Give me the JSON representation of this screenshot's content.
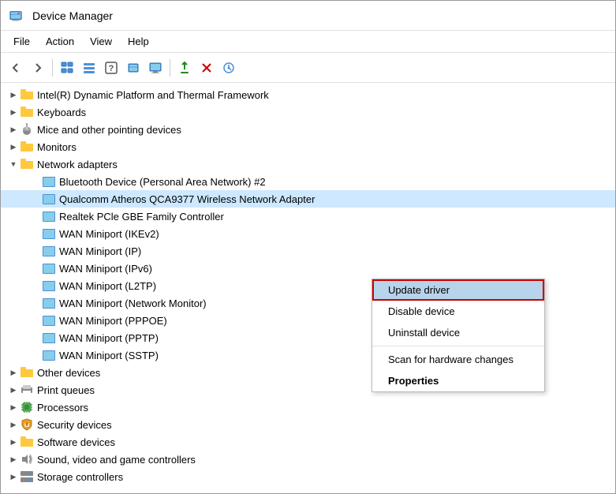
{
  "window": {
    "title": "Device Manager"
  },
  "menubar": {
    "items": [
      "File",
      "Action",
      "View",
      "Help"
    ]
  },
  "toolbar": {
    "buttons": [
      {
        "name": "back",
        "symbol": "◀"
      },
      {
        "name": "forward",
        "symbol": "▶"
      },
      {
        "name": "tree-view",
        "symbol": "⊞"
      },
      {
        "name": "list-view",
        "symbol": "☰"
      },
      {
        "name": "help",
        "symbol": "?"
      },
      {
        "name": "resources-by-type",
        "symbol": "⊟"
      },
      {
        "name": "monitor",
        "symbol": "🖥"
      },
      {
        "name": "update",
        "symbol": "↑"
      },
      {
        "name": "uninstall",
        "symbol": "✖"
      },
      {
        "name": "scan",
        "symbol": "⊕"
      }
    ]
  },
  "tree": {
    "items": [
      {
        "id": "intel-dynamic",
        "level": 1,
        "expanded": false,
        "label": "Intel(R) Dynamic Platform and Thermal Framework",
        "icon": "folder"
      },
      {
        "id": "keyboards",
        "level": 1,
        "expanded": false,
        "label": "Keyboards",
        "icon": "folder"
      },
      {
        "id": "mice",
        "level": 1,
        "expanded": false,
        "label": "Mice and other pointing devices",
        "icon": "mouse"
      },
      {
        "id": "monitors",
        "level": 1,
        "expanded": false,
        "label": "Monitors",
        "icon": "monitor"
      },
      {
        "id": "network-adapters",
        "level": 1,
        "expanded": true,
        "label": "Network adapters",
        "icon": "folder"
      },
      {
        "id": "bluetooth",
        "level": 2,
        "expanded": false,
        "label": "Bluetooth Device (Personal Area Network) #2",
        "icon": "net"
      },
      {
        "id": "qualcomm",
        "level": 2,
        "expanded": false,
        "label": "Qualcomm Atheros QCA9377 Wireless Network Adapter",
        "icon": "net",
        "selected": true
      },
      {
        "id": "realtek",
        "level": 2,
        "expanded": false,
        "label": "Realtek PCle GBE Family Controller",
        "icon": "net"
      },
      {
        "id": "wan-ikev2",
        "level": 2,
        "expanded": false,
        "label": "WAN Miniport (IKEv2)",
        "icon": "net"
      },
      {
        "id": "wan-ip",
        "level": 2,
        "expanded": false,
        "label": "WAN Miniport (IP)",
        "icon": "net"
      },
      {
        "id": "wan-ipv6",
        "level": 2,
        "expanded": false,
        "label": "WAN Miniport (IPv6)",
        "icon": "net"
      },
      {
        "id": "wan-l2tp",
        "level": 2,
        "expanded": false,
        "label": "WAN Miniport (L2TP)",
        "icon": "net"
      },
      {
        "id": "wan-netmon",
        "level": 2,
        "expanded": false,
        "label": "WAN Miniport (Network Monitor)",
        "icon": "net"
      },
      {
        "id": "wan-pppoe",
        "level": 2,
        "expanded": false,
        "label": "WAN Miniport (PPPOE)",
        "icon": "net"
      },
      {
        "id": "wan-pptp",
        "level": 2,
        "expanded": false,
        "label": "WAN Miniport (PPTP)",
        "icon": "net"
      },
      {
        "id": "wan-sstp",
        "level": 2,
        "expanded": false,
        "label": "WAN Miniport (SSTP)",
        "icon": "net"
      },
      {
        "id": "other-devices",
        "level": 1,
        "expanded": false,
        "label": "Other devices",
        "icon": "folder"
      },
      {
        "id": "print-queues",
        "level": 1,
        "expanded": false,
        "label": "Print queues",
        "icon": "printer"
      },
      {
        "id": "processors",
        "level": 1,
        "expanded": false,
        "label": "Processors",
        "icon": "cpu"
      },
      {
        "id": "security-devices",
        "level": 1,
        "expanded": false,
        "label": "Security devices",
        "icon": "security"
      },
      {
        "id": "software-devices",
        "level": 1,
        "expanded": false,
        "label": "Software devices",
        "icon": "folder"
      },
      {
        "id": "sound-video",
        "level": 1,
        "expanded": false,
        "label": "Sound, video and game controllers",
        "icon": "sound"
      },
      {
        "id": "storage-controllers",
        "level": 1,
        "expanded": false,
        "label": "Storage controllers",
        "icon": "storage"
      }
    ]
  },
  "context_menu": {
    "items": [
      {
        "id": "update-driver",
        "label": "Update driver",
        "bold": false,
        "active": true
      },
      {
        "id": "disable-device",
        "label": "Disable device",
        "bold": false
      },
      {
        "id": "uninstall-device",
        "label": "Uninstall device",
        "bold": false
      },
      {
        "separator": true
      },
      {
        "id": "scan-hardware",
        "label": "Scan for hardware changes",
        "bold": false
      },
      {
        "separator": false
      },
      {
        "id": "properties",
        "label": "Properties",
        "bold": true
      }
    ]
  }
}
